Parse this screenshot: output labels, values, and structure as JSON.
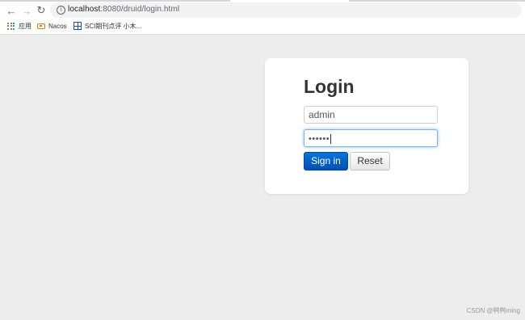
{
  "browser": {
    "url_host": "localhost",
    "url_rest": ":8080/druid/login.html",
    "bookmarks": [
      {
        "label": "应用",
        "icon": "apps-grid-icon"
      },
      {
        "label": "Nacos",
        "icon": "nacos-icon"
      },
      {
        "label": "SCI期刊点评 小木...",
        "icon": "sci-icon"
      }
    ]
  },
  "login": {
    "title": "Login",
    "username_value": "admin",
    "password_mask": "••••••",
    "signin_label": "Sign in",
    "reset_label": "Reset"
  },
  "watermark": "CSDN @鸭鸭ming",
  "colors": {
    "page_bg": "#ededed",
    "primary": "#0a74d8"
  }
}
